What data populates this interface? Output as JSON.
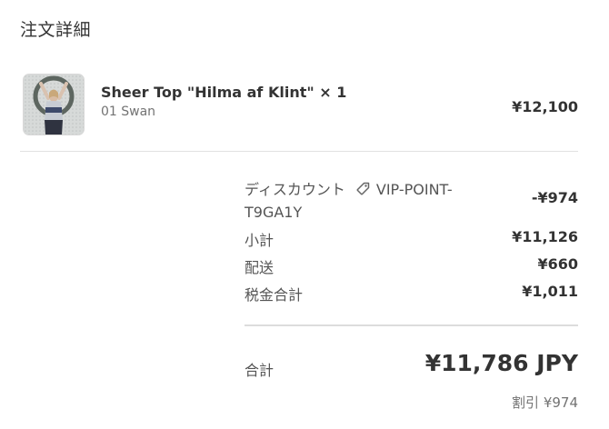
{
  "heading": "注文詳細",
  "product": {
    "name": "Sheer Top \"Hilma af Klint\" × 1",
    "variant": "01 Swan",
    "price": "¥12,100",
    "image_icon": "product-photo"
  },
  "summary": {
    "discount_label": "ディスカウント",
    "discount_code": "VIP-POINT-T9GA1Y",
    "discount_icon": "tag-icon",
    "discount_value": "-¥974",
    "subtotal_label": "小計",
    "subtotal_value": "¥11,126",
    "shipping_label": "配送",
    "shipping_value": "¥660",
    "tax_label": "税金合計",
    "tax_value": "¥1,011"
  },
  "total": {
    "label": "合計",
    "value": "¥11,786 JPY",
    "savings": "割引 ¥974"
  }
}
